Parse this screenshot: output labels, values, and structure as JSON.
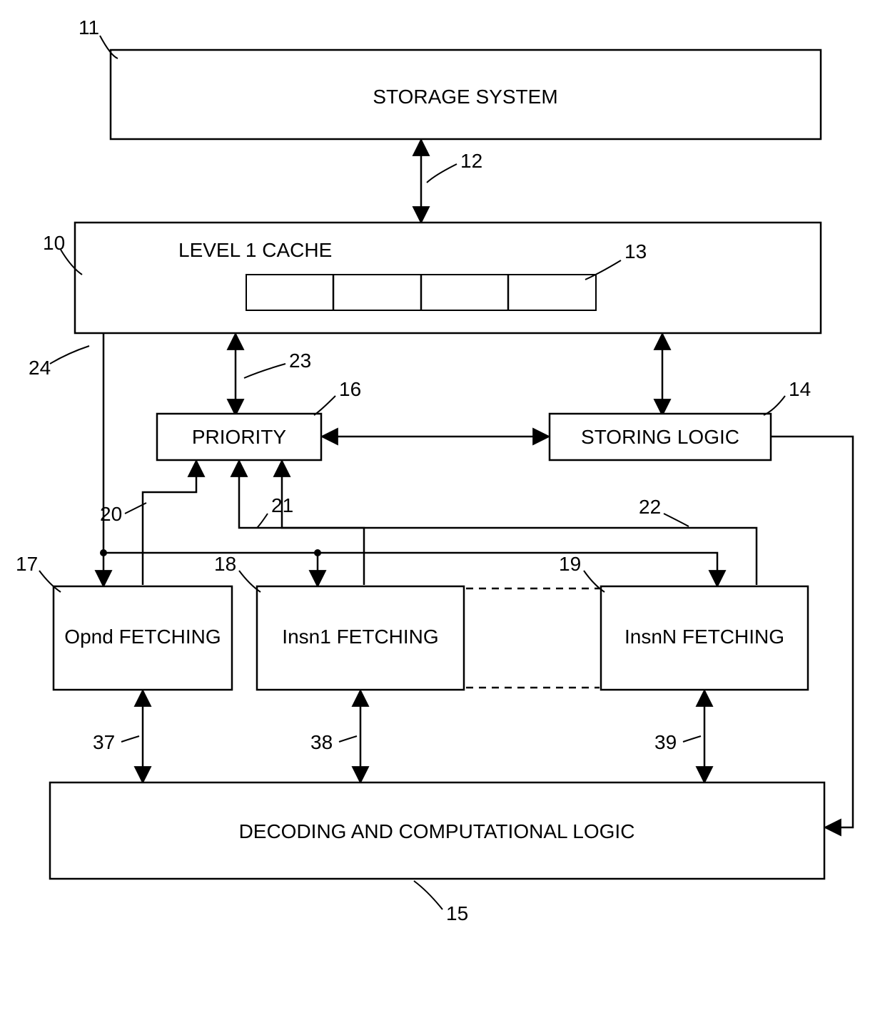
{
  "blocks": {
    "storage": {
      "label": "STORAGE SYSTEM",
      "ref": "11"
    },
    "cache": {
      "label": "LEVEL 1 CACHE",
      "ref": "10"
    },
    "cacheline": {
      "ref": "13"
    },
    "priority": {
      "label": "PRIORITY",
      "ref": "16"
    },
    "storing": {
      "label": "STORING LOGIC",
      "ref": "14"
    },
    "opnd": {
      "label": "Opnd FETCHING",
      "ref": "17"
    },
    "insn1": {
      "label": "Insn1 FETCHING",
      "ref": "18"
    },
    "insnN": {
      "label": "InsnN FETCHING",
      "ref": "19"
    },
    "decode": {
      "label": "DECODING AND COMPUTATIONAL LOGIC",
      "ref": "15"
    }
  },
  "connectors": {
    "c12": {
      "ref": "12"
    },
    "c23": {
      "ref": "23"
    },
    "c24": {
      "ref": "24"
    },
    "c20": {
      "ref": "20"
    },
    "c21": {
      "ref": "21"
    },
    "c22": {
      "ref": "22"
    },
    "c37": {
      "ref": "37"
    },
    "c38": {
      "ref": "38"
    },
    "c39": {
      "ref": "39"
    }
  }
}
